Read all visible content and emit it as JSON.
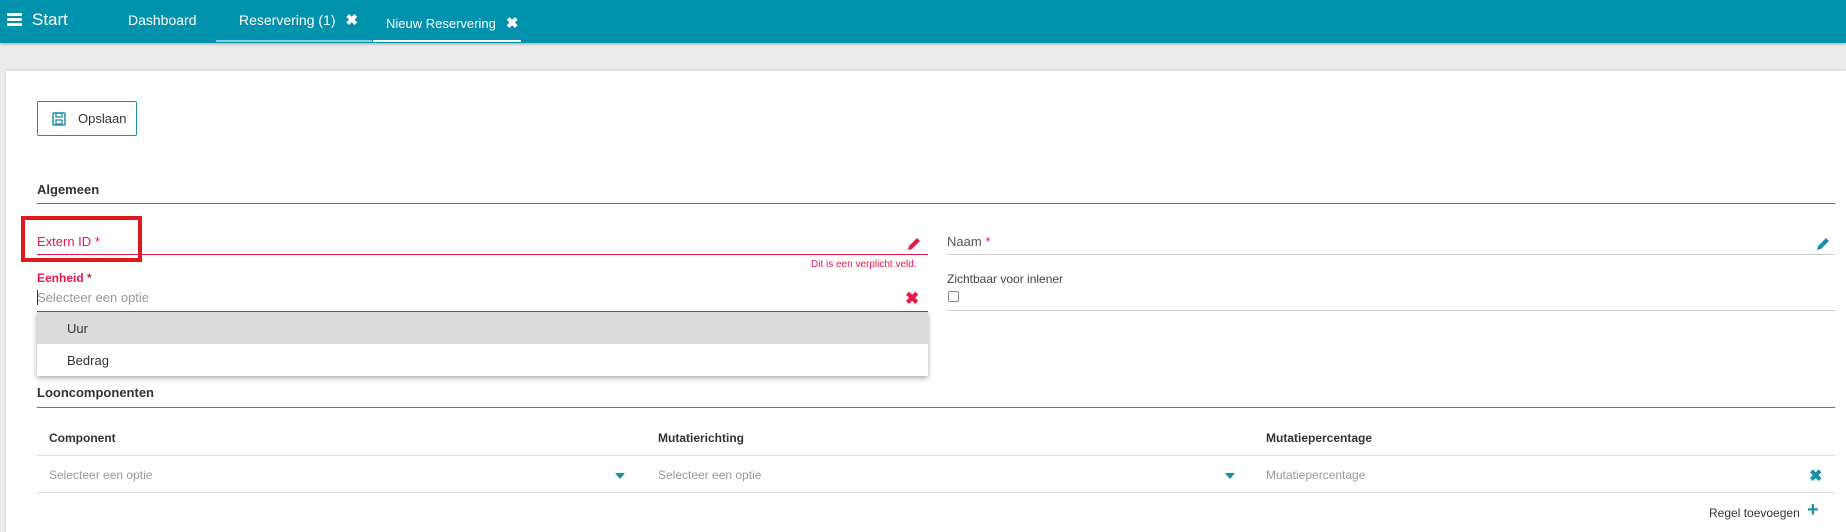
{
  "header": {
    "menu_icon": "hamburger-icon",
    "brand": "Start",
    "tabs": [
      {
        "label": "Dashboard"
      },
      {
        "label": "Reservering (1)",
        "close": "✖"
      },
      {
        "label": "Nieuw Reservering",
        "close": "✖"
      }
    ]
  },
  "toolbar": {
    "save_label": "Opslaan",
    "save_icon": "floppy-disk-icon"
  },
  "algemeen": {
    "title": "Algemeen",
    "extern_id": {
      "label": "Extern ID",
      "required": "*",
      "error": "Dit is een verplicht veld.",
      "icon": "pencil-icon"
    },
    "naam": {
      "label": "Naam",
      "required": "*",
      "icon": "pencil-icon"
    },
    "eenheid": {
      "label": "Eenheid",
      "required": "*",
      "placeholder": "Selecteer een optie",
      "clear": "✖",
      "options": [
        "Uur",
        "Bedrag"
      ]
    },
    "zichtbaar": {
      "label": "Zichtbaar voor inlener",
      "checked": false
    }
  },
  "looncomponenten": {
    "title": "Looncomponenten",
    "columns": [
      "Component",
      "Mutatierichting",
      "Mutatiepercentage"
    ],
    "row": {
      "component_placeholder": "Selecteer een optie",
      "mutatierichting_placeholder": "Selecteer een optie",
      "mutatiepercentage_placeholder": "Mutatiepercentage",
      "remove": "✖"
    },
    "add_label": "Regel toevoegen",
    "add_icon": "+"
  },
  "colors": {
    "primary": "#0091ad",
    "accent": "#1e8fa6",
    "error": "#e8194a",
    "highlight": "#e0191f"
  }
}
